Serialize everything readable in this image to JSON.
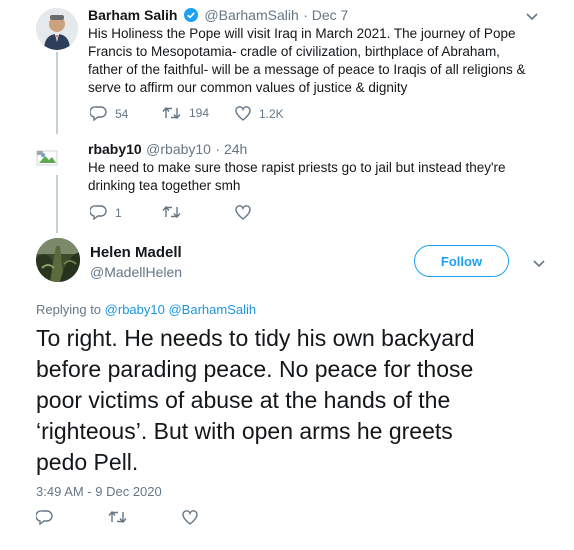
{
  "tweet1": {
    "name": "Barham Salih",
    "handle": "@BarhamSalih",
    "date": "· Dec 7",
    "text": "His Holiness the Pope will visit Iraq in March 2021. The journey of Pope Francis to Mesopotamia- cradle of civilization, birthplace of Abraham, father of the faithful- will be a message of peace to Iraqis of all religions & serve to affirm our common values of justice & dignity",
    "replies": "54",
    "retweets": "194",
    "likes": "1.2K"
  },
  "tweet2": {
    "name": "rbaby10",
    "handle": "@rbaby10",
    "date": "· 24h",
    "text": "He need to make sure those rapist priests go to jail but instead they're drinking tea together smh",
    "replies": "1",
    "retweets": "",
    "likes": ""
  },
  "main": {
    "name": "Helen Madell",
    "handle": "@MadellHelen",
    "follow_label": "Follow",
    "replying_prefix": "Replying to",
    "replying_to": [
      "@rbaby10",
      "@BarhamSalih"
    ],
    "text_lines": [
      "To right. He needs to tidy his own backyard",
      "before parading peace. No peace for those",
      "poor victims of abuse at the hands of the",
      "‘righteous’. But with open arms he greets",
      "pedo Pell."
    ],
    "timestamp": "3:49 AM - 9 Dec 2020"
  },
  "colors": {
    "accent": "#1da1f2",
    "link": "#1b95e0",
    "muted": "#657786",
    "verified": "#1da1f2"
  }
}
